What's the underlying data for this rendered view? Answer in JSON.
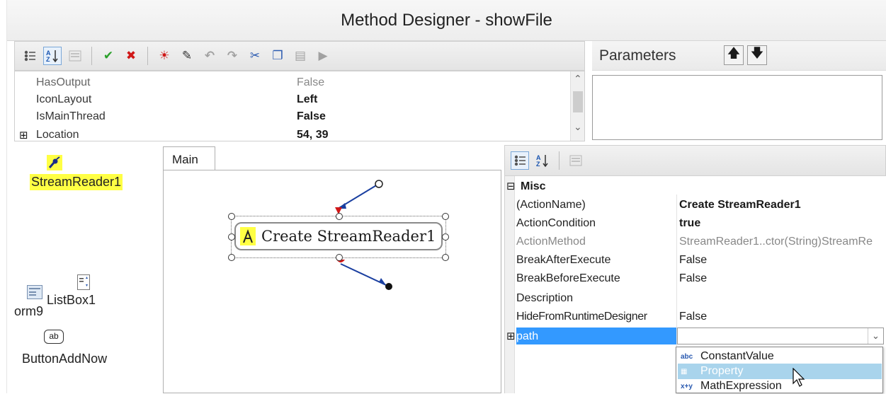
{
  "window": {
    "title": "Method Designer - showFile"
  },
  "toolbar": {
    "icons": [
      "categorized-icon",
      "alphabetical-icon",
      "property-pages-icon",
      "ok-icon",
      "cancel-icon",
      "debug-icon",
      "wand-icon",
      "undo-icon",
      "redo-icon",
      "cut-icon",
      "copy-icon",
      "paste-icon",
      "run-icon"
    ]
  },
  "parameters": {
    "label": "Parameters",
    "move_up": "🡅",
    "move_down": "🡇"
  },
  "top_grid": {
    "rows": [
      {
        "key": "HasOutput",
        "value": "False",
        "dim": true
      },
      {
        "key": "IconLayout",
        "value": "Left",
        "bold": true
      },
      {
        "key": "IsMainThread",
        "value": "False",
        "bold": true
      },
      {
        "key": "Location",
        "value": "54, 39",
        "expand": "⊞",
        "bold": true
      }
    ],
    "scroll_up": "⌃",
    "scroll_down": "⌄"
  },
  "components": {
    "streamreader": "StreamReader1",
    "listbox": "ListBox1",
    "form": "orm9",
    "button": "ButtonAddNow",
    "button_icon_text": "ab"
  },
  "designer": {
    "tab": "Main",
    "action_label": "Create StreamReader1"
  },
  "right_grid": {
    "category": "Misc",
    "rows": [
      {
        "key": "(ActionName)",
        "value": "Create StreamReader1",
        "bold": true
      },
      {
        "key": "ActionCondition",
        "value": "true",
        "bold": true
      },
      {
        "key": "ActionMethod",
        "value": "StreamReader1..ctor(String)StreamRe",
        "dim": true
      },
      {
        "key": "BreakAfterExecute",
        "value": "False"
      },
      {
        "key": "BreakBeforeExecute",
        "value": "False"
      },
      {
        "key": "Description",
        "value": ""
      },
      {
        "key": "HideFromRuntimeDesigner",
        "value": "False"
      }
    ],
    "path_label": "path",
    "dropdown_items": [
      {
        "icon": "abc",
        "label": "ConstantValue"
      },
      {
        "icon": "▦",
        "label": "Property"
      },
      {
        "icon": "x+y",
        "label": "MathExpression"
      }
    ]
  },
  "colors": {
    "selection": "#3399ff",
    "highlight": "#ffff44",
    "hover": "#a9d4ec",
    "connector": "#1a3fa0"
  }
}
